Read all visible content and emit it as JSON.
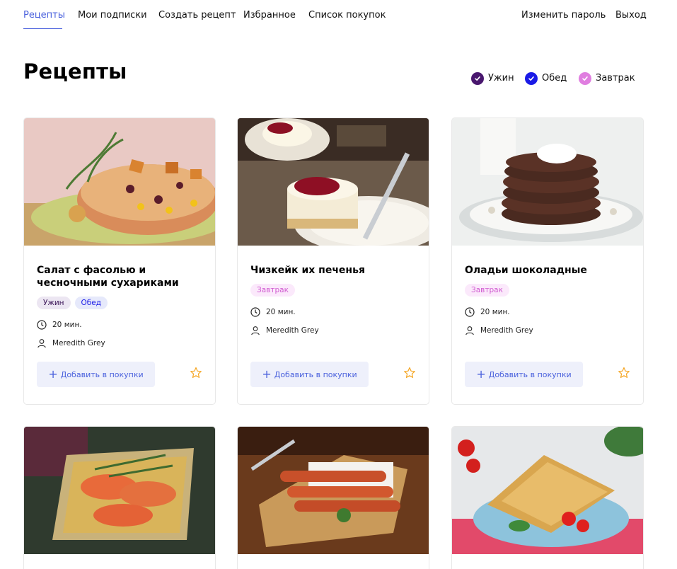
{
  "nav": {
    "recipes": "Рецепты",
    "subscriptions": "Мои подписки",
    "create": "Создать рецепт",
    "favorites": "Избранное",
    "shopping": "Список покупок",
    "change_password": "Изменить пароль",
    "logout": "Выход"
  },
  "page": {
    "title": "Рецепты"
  },
  "filters": [
    {
      "label": "Ужин",
      "color": "#49176e"
    },
    {
      "label": "Обед",
      "color": "#1a1ae6"
    },
    {
      "label": "Завтрак",
      "color": "#e07ee0"
    }
  ],
  "colors": {
    "accent": "#4a61dd",
    "tag_dinner_bg": "#ece6f2",
    "tag_lunch_bg": "#e6e9fb",
    "tag_breakfast_bg": "#fbe9fb",
    "star": "#f5a623"
  },
  "cards": [
    {
      "title": "Салат с фасолью и чесночными сухариками",
      "tags": [
        "Ужин",
        "Обед"
      ],
      "time": "20 мин.",
      "author": "Meredith Grey",
      "add_label": "Добавить в покупки"
    },
    {
      "title": "Чизкейк их печенья",
      "tags": [
        "Завтрак"
      ],
      "time": "20 мин.",
      "author": "Meredith Grey",
      "add_label": "Добавить в покупки"
    },
    {
      "title": "Оладьи шоколадные",
      "tags": [
        "Завтрак"
      ],
      "time": "20 мин.",
      "author": "Meredith Grey",
      "add_label": "Добавить в покупки"
    }
  ],
  "icons": {
    "clock": "clock-icon",
    "user": "user-icon",
    "star": "star-icon",
    "check": "check-icon",
    "plus": "plus-icon"
  }
}
